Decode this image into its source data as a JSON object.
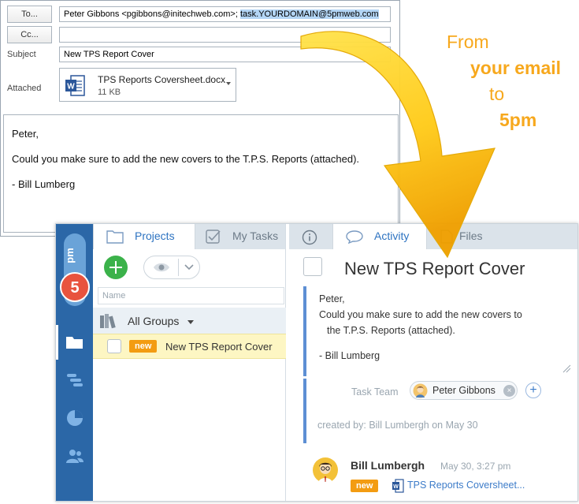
{
  "email": {
    "to_label": "To...",
    "cc_label": "Cc...",
    "subject_label": "Subject",
    "attached_label": "Attached",
    "to_value": "Peter Gibbons <pgibbons@initechweb.com>;",
    "to_selected": "task.YOURDOMAIN@5pmweb.com",
    "cc_value": "",
    "subject_value": "New TPS Report Cover",
    "attachment": {
      "name": "TPS Reports Coversheet.docx",
      "size": "11 KB",
      "icon": "word-icon"
    },
    "body": {
      "greeting": "Peter,",
      "message": "Could you make sure to add the new covers to the T.P.S. Reports (attached).",
      "signature": "- Bill Lumberg"
    }
  },
  "tagline": {
    "line1": "From",
    "line2": "your email",
    "line3": "to",
    "line4": "5pm",
    "color": "#f7a81d"
  },
  "app": {
    "accent": "#2b67a7",
    "nav_icons": [
      "5pm-logo",
      "folder-icon",
      "gantt-icon",
      "pie-chart-icon",
      "users-icon"
    ],
    "tabs_left": {
      "projects": "Projects",
      "my_tasks": "My Tasks"
    },
    "tabs_right": {
      "activity": "Activity",
      "files": "Files"
    },
    "search_placeholder": "Name",
    "groups_label": "All Groups",
    "task": {
      "badge": "new",
      "title": "New TPS Report Cover"
    },
    "detail": {
      "title": "New TPS Report Cover",
      "description": [
        "Peter,",
        "Could you make sure to add the new covers to",
        "the T.P.S. Reports (attached).",
        "",
        "- Bill Lumberg"
      ],
      "team_label": "Task Team",
      "team_member": "Peter Gibbons",
      "created": "created by: Bill Lumbergh on May 30"
    },
    "activity": {
      "author": "Bill Lumbergh",
      "time": "May 30, 3:27 pm",
      "badge": "new",
      "file": "TPS Reports Coversheet..."
    }
  }
}
